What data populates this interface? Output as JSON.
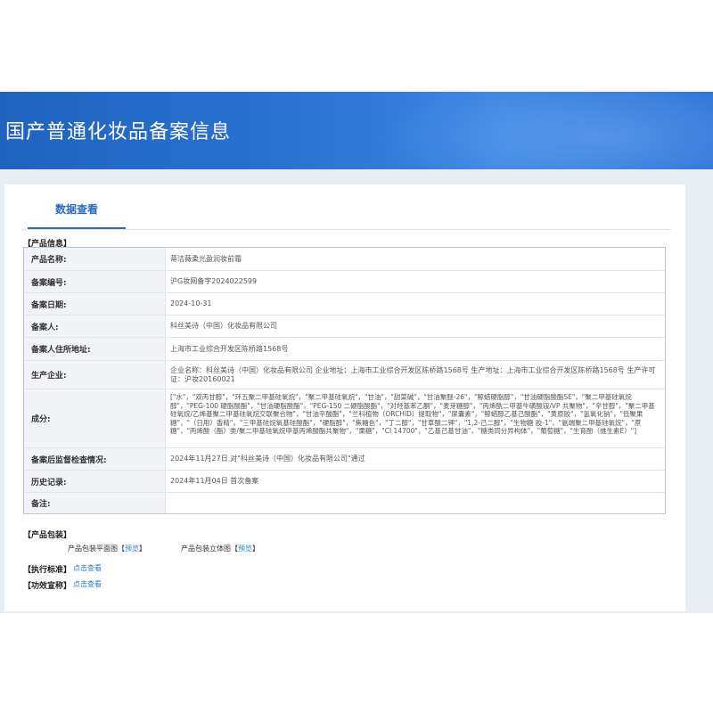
{
  "header": {
    "title": "国产普通化妆品备案信息"
  },
  "tabs": [
    {
      "label": "数据查看"
    }
  ],
  "product_info": {
    "section_title": "【产品信息】",
    "rows": [
      {
        "label": "产品名称:",
        "value": "蒂洁薇柔光盈润妆前霜"
      },
      {
        "label": "备案编号:",
        "value": "沪G妆网备字2024022599"
      },
      {
        "label": "备案日期:",
        "value": "2024-10-31"
      },
      {
        "label": "备案人:",
        "value": "科丝美诗（中国）化妆品有限公司"
      },
      {
        "label": "备案人住所地址:",
        "value": "上海市工业综合开发区陈桥路1568号"
      },
      {
        "label": "生产企业:",
        "value": "企业名称：科丝美诗（中国）化妆品有限公司 企业地址：上海市工业综合开发区陈桥路1568号 生产地址：上海市工业综合开发区陈桥路1568号 生产许可证：沪妆20160021"
      },
      {
        "label": "成分:",
        "value": "[\"水\"，\"双丙甘醇\"，\"环五聚二甲基硅氧烷\"，\"聚二甲基硅氧烷\"，\"甘油\"，\"甜菜碱\"，\"甘油聚醚-26\"，\"鲸蜡硬脂醇\"，\"甘油硬脂酸酯SE\"，\"聚二甲基硅氧烷醇\"，\"PEG-100 硬脂酸酯\"，\"甘油硬脂酸酯\"，\"PEG-150 二硬脂酸酯\"，\"对羟基苯乙酮\"，\"麦芽糖醇\"，\"丙烯酰二甲基牛磺酸铵/VP 共聚物\"，\"辛甘醇\"，\"聚二甲基硅氧烷/乙烯基聚二甲基硅氧烷交联聚合物\"，\"甘油辛酸酯\"，\"兰科植物（ORCHID）提取物\"，\"尿囊素\"，\"鲸蜡醇乙基己酸酯\"，\"黄原胶\"，\"氢氧化钠\"，\"低聚果糖\"，\"（日用）香精\"，\"三甲基硅烷氧基硅酸酯\"，\"硬脂醇\"，\"焦糖色\"，\"丁二醇\"，\"甘草酸二钾\"，\"1,2-己二醇\"，\"生物糖 胶-1\"，\"氨端聚二甲基硅氧烷\"，\"蔗糖\"，\"丙烯酸（酯）类/聚二甲基硅氧烷甲基丙烯酸酯共聚物\"，\"果糖\"，\"CI 14700\"，\"乙基己基甘油\"，\"糖类同分异构体\"，\"葡萄糖\"，\"生育酚（维生素E）\"]"
      },
      {
        "label": "备案后监督检查情况:",
        "value": "2024年11月27日 对\"科丝美诗（中国）化妆品有限公司\"通过"
      },
      {
        "label": "历史记录:",
        "value": "2024年11月04日 首次备案"
      },
      {
        "label": "备注:",
        "value": ""
      }
    ]
  },
  "packaging": {
    "section_title": "【产品包装】",
    "flat_label": "产品包装平面图",
    "solid_label": "产品包装立体图",
    "preview_label": "预览",
    "bracket_open": "【",
    "bracket_close": "】"
  },
  "standard": {
    "title": "【执行标准】",
    "link": "点击查看"
  },
  "efficacy": {
    "title": "【功效宣称】",
    "link": "点击查看"
  }
}
